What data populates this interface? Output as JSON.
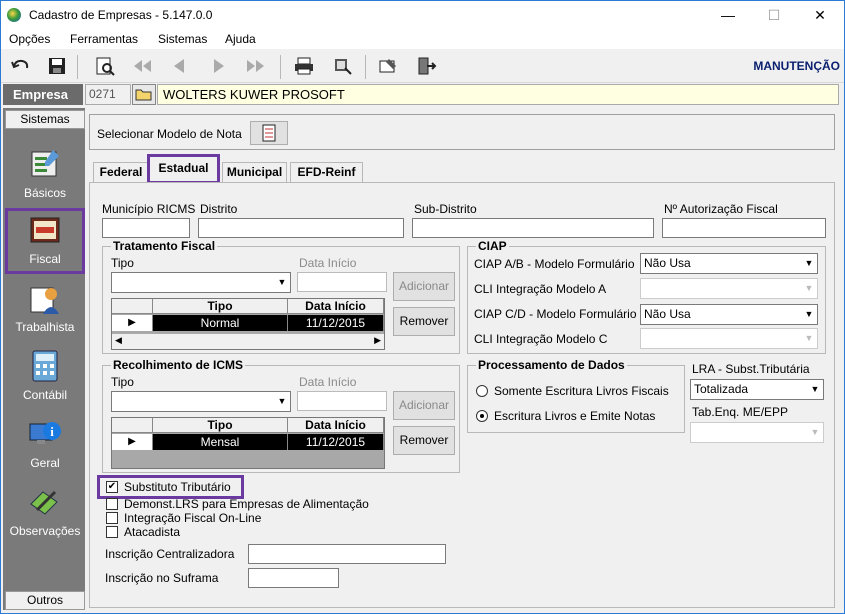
{
  "window": {
    "title": "Cadastro de Empresas - 5.147.0.0",
    "min": "—",
    "max": "☐",
    "close": "✕"
  },
  "menu": [
    "Opções",
    "Ferramentas",
    "Sistemas",
    "Ajuda"
  ],
  "toolbar": {
    "mode": "MANUTENÇÃO"
  },
  "empresa": {
    "label": "Empresa",
    "code": "0271",
    "name": "WOLTERS KUWER PROSOFT"
  },
  "sidebar": {
    "header": "Sistemas",
    "footer": "Outros",
    "items": [
      {
        "label": "Básicos",
        "icon": "basicos-icon"
      },
      {
        "label": "Fiscal",
        "icon": "fiscal-icon"
      },
      {
        "label": "Trabalhista",
        "icon": "trabalhista-icon"
      },
      {
        "label": "Contábil",
        "icon": "contabil-icon"
      },
      {
        "label": "Geral",
        "icon": "geral-icon"
      },
      {
        "label": "Observações",
        "icon": "observacoes-icon"
      }
    ]
  },
  "modelo": {
    "label": "Selecionar Modelo de Nota"
  },
  "tabs": [
    "Federal",
    "Estadual",
    "Municipal",
    "EFD-Reinf"
  ],
  "fields": {
    "municipio_ricms": {
      "label": "Município RICMS",
      "value": ""
    },
    "distrito": {
      "label": "Distrito",
      "value": ""
    },
    "sub_distrito": {
      "label": "Sub-Distrito",
      "value": ""
    },
    "autorizacao": {
      "label": "Nº Autorização Fiscal",
      "value": ""
    }
  },
  "tratamento": {
    "title": "Tratamento Fiscal",
    "tipo_label": "Tipo",
    "data_label": "Data Início",
    "add": "Adicionar",
    "remove": "Remover",
    "cols": [
      "Tipo",
      "Data Início"
    ],
    "rows": [
      {
        "tipo": "Normal",
        "data": "11/12/2015"
      }
    ]
  },
  "recolhimento": {
    "title": "Recolhimento de ICMS",
    "tipo_label": "Tipo",
    "data_label": "Data Início",
    "add": "Adicionar",
    "remove": "Remover",
    "cols": [
      "Tipo",
      "Data Início"
    ],
    "rows": [
      {
        "tipo": "Mensal",
        "data": "11/12/2015"
      }
    ]
  },
  "ciap": {
    "title": "CIAP",
    "ab_label": "CIAP  A/B - Modelo Formulário",
    "ab_value": "Não Usa",
    "cli_a_label": "CLI Integração Modelo A",
    "cd_label": "CIAP C/D - Modelo Formulário",
    "cd_value": "Não Usa",
    "cli_c_label": "CLI Integração Modelo C"
  },
  "processamento": {
    "title": "Processamento de Dados",
    "opt1": "Somente Escritura Livros Fiscais",
    "opt2": "Escritura Livros e Emite Notas",
    "selected": 2
  },
  "lra": {
    "label": "LRA - Subst.Tributária",
    "value": "Totalizada",
    "tab_label": "Tab.Enq. ME/EPP"
  },
  "checks": {
    "substituto": {
      "label": "Substituto Tributário",
      "checked": true
    },
    "demonst": {
      "label": "Demonst.LRS para Empresas de Alimentação",
      "checked": false
    },
    "integracao": {
      "label": "Integração Fiscal On-Line",
      "checked": false
    },
    "atacadista": {
      "label": "Atacadista",
      "checked": false
    }
  },
  "inscricao": {
    "centralizadora": "Inscrição Centralizadora",
    "suframa": "Inscrição no Suframa"
  },
  "colors": {
    "highlight": "#6a3aa0",
    "sidebar": "#7a7a7a",
    "name_bg": "#ffffe1"
  }
}
